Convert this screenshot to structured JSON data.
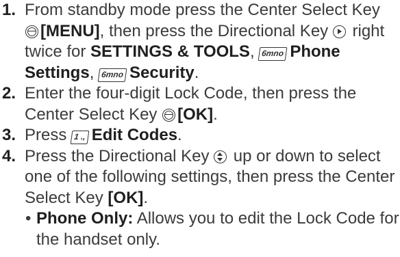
{
  "steps": [
    {
      "num": "1.",
      "t1": "From standby mode press the Center Select Key ",
      "b1": "[MENU]",
      "t2": ", then press the Directional Key ",
      "t3": " right twice for ",
      "b2": "SETTINGS & TOOLS",
      "t4": ", ",
      "key1": "6mno",
      "b3": "Phone Settings",
      "t5": ", ",
      "key2": "6mno",
      "b4": "Security",
      "t6": "."
    },
    {
      "num": "2.",
      "t1": "Enter the four-digit Lock Code, then press the Center Select Key ",
      "b1": "[OK]",
      "t2": "."
    },
    {
      "num": "3.",
      "t1": "Press ",
      "key1": "1 .,",
      "b1": "Edit Codes",
      "t2": "."
    },
    {
      "num": "4.",
      "t1": "Press the Directional Key ",
      "t2": " up or down to select one of the following settings, then press the Center Select Key ",
      "b1": "[OK]",
      "t3": ".",
      "bullets": [
        {
          "bullet": "•",
          "label": "Phone Only:",
          "text": " Allows you to edit the Lock Code for the handset only."
        }
      ]
    }
  ],
  "icons": {
    "center_select_key": "center-select-key-icon",
    "directional_right": "directional-key-right-icon",
    "directional_updown": "directional-key-updown-icon",
    "number_key": "number-key-icon"
  }
}
